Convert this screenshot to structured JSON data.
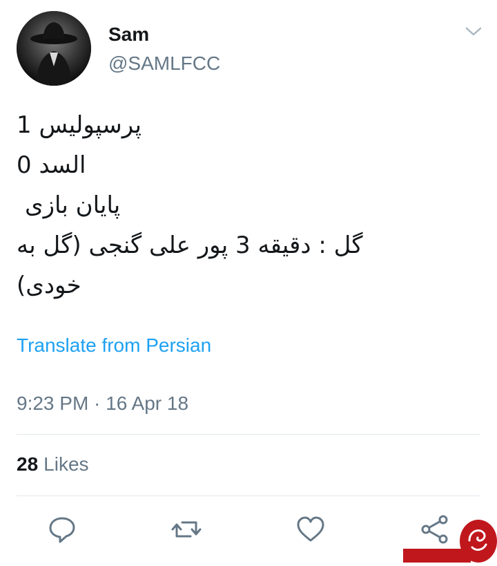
{
  "tweet": {
    "author": {
      "display_name": "Sam",
      "handle": "@SAMLFCC"
    },
    "text_lines": [
      "پرسپولیس 1",
      "السد 0",
      "پایان بازی",
      "گل : دقیقه 3 پور علی گنجی (گل به",
      "خودی)"
    ],
    "translate_label": "Translate from Persian",
    "timestamp": "9:23 PM · 16 Apr 18",
    "likes": {
      "count": "28",
      "label": "Likes"
    }
  },
  "icons": {
    "caret": "chevron-down-icon",
    "reply": "reply-icon",
    "retweet": "retweet-icon",
    "like": "heart-icon",
    "share": "share-icon"
  },
  "colors": {
    "text_primary": "#14171a",
    "text_secondary": "#657786",
    "link": "#1da1f2",
    "divider": "#e1e8ed",
    "watermark": "#c0171d"
  }
}
